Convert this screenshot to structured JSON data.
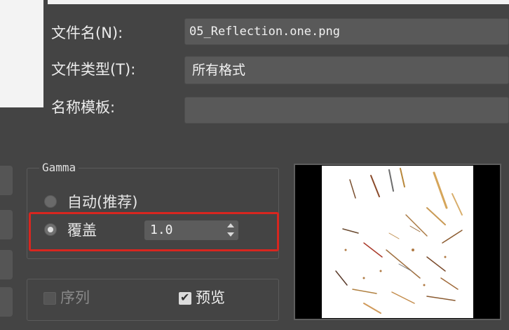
{
  "labels": {
    "file_name": "文件名(N):",
    "file_type": "文件类型(T):",
    "name_template": "名称模板:"
  },
  "fields": {
    "file_name_value": "05_Reflection.one.png",
    "file_type_value": "所有格式",
    "name_template_value": ""
  },
  "gamma": {
    "title": "Gamma",
    "auto_label": "自动(推荐)",
    "override_label": "覆盖",
    "override_value": "1.0",
    "selected": "override"
  },
  "options": {
    "sequence_label": "序列",
    "sequence_checked": false,
    "preview_label": "预览",
    "preview_checked": true
  },
  "colors": {
    "highlight": "#d8261f",
    "background": "#444444"
  }
}
